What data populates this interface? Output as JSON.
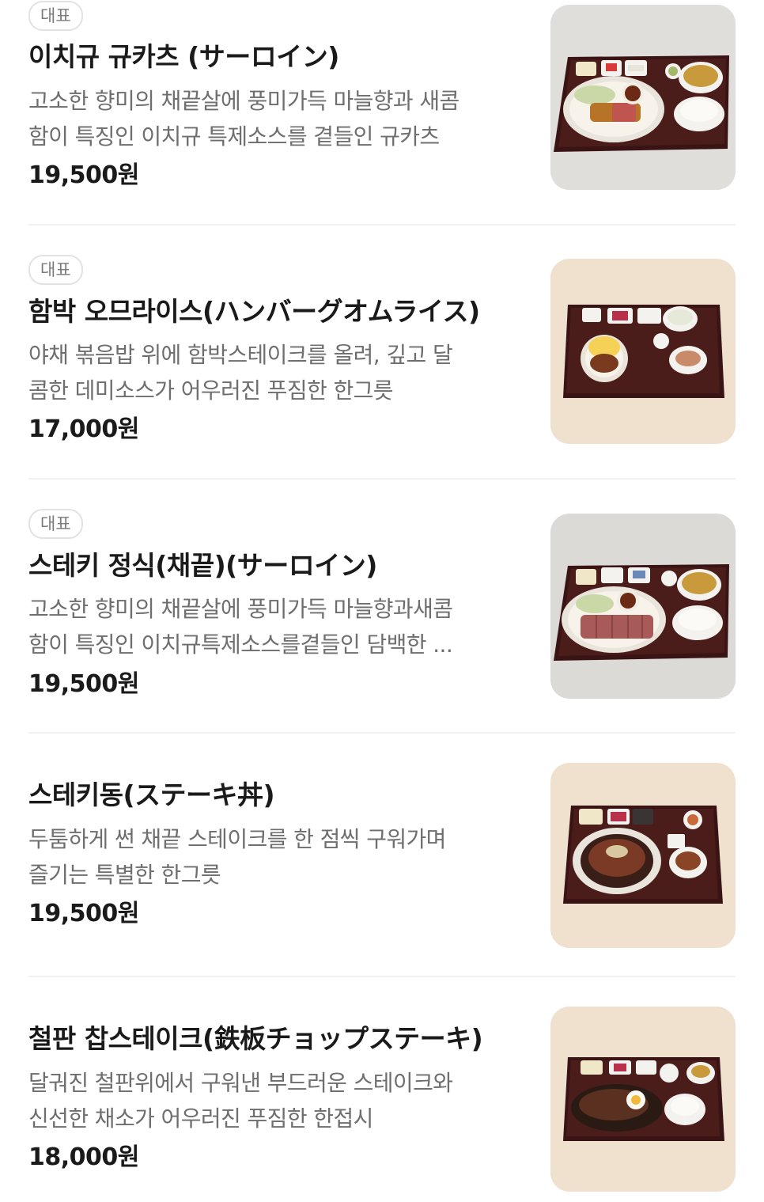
{
  "menu": {
    "items": [
      {
        "badge": "대표",
        "name": "이치규 규카츠 (サーロイン)",
        "desc_lines": [
          "고소한 향미의 채끝살에 풍미가득 마늘향과 새콤",
          "함이 특징인 이치규 특제소스를 곁들인 규카츠"
        ],
        "price": "19,500원",
        "image": "gyukatsu-set-photo"
      },
      {
        "badge": "대표",
        "name": "함박 오므라이스(ハンバーグオムライス)",
        "desc_lines": [
          "야채 볶음밥 위에 함박스테이크를 올려, 깊고 달",
          "콤한 데미소스가 어우러진 푸짐한 한그릇"
        ],
        "price": "17,000원",
        "image": "hamburg-omurice-set-photo"
      },
      {
        "badge": "대표",
        "name": "스테키 정식(채끝)(サーロイン)",
        "desc_lines": [
          "고소한 향미의 채끝살에 풍미가득 마늘향과새콤",
          "함이 특징인 이치규특제소스를곁들인 담백한 ..."
        ],
        "price": "19,500원",
        "image": "steak-set-photo"
      },
      {
        "badge": "",
        "name": "스테키동(ステーキ丼)",
        "desc_lines": [
          "두툼하게 썬 채끝 스테이크를 한 점씩 구워가며",
          "즐기는 특별한 한그릇"
        ],
        "price": "19,500원",
        "image": "steak-don-set-photo"
      },
      {
        "badge": "",
        "name": "철판 찹스테이크(鉄板チョップステーキ)",
        "desc_lines": [
          "달궈진 철판위에서 구워낸 부드러운 스테이크와",
          "신선한 채소가 어우러진 푸짐한 한접시"
        ],
        "price": "18,000원",
        "image": "teppan-chop-steak-set-photo"
      }
    ]
  },
  "colors": {
    "text_primary": "#1a1a1a",
    "text_secondary": "#6e6e6e",
    "badge_text": "#7a7a7a",
    "divider": "#f1f1f1",
    "tray": "#3a1414"
  }
}
